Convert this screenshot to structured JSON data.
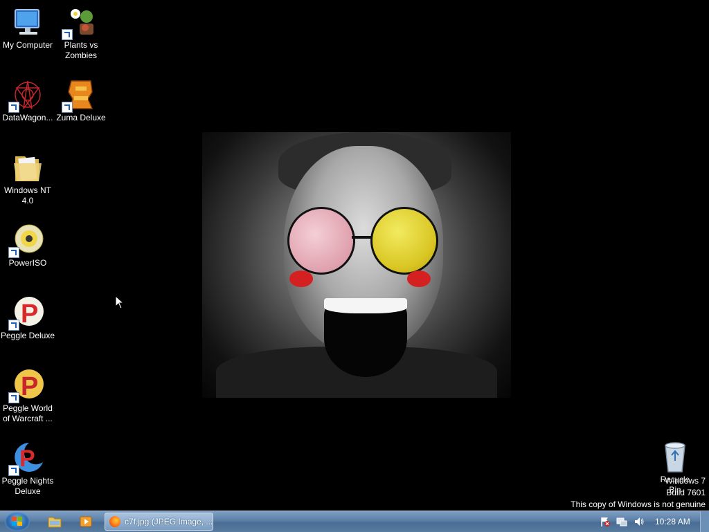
{
  "desktop": {
    "icons": [
      {
        "label": "My Computer",
        "icon": "computer-icon"
      },
      {
        "label": "Plants vs Zombies",
        "icon": "plants-vs-zombies-icon"
      },
      {
        "label": "DataWagon...",
        "icon": "datawagon-icon"
      },
      {
        "label": "Zuma Deluxe",
        "icon": "zuma-deluxe-icon"
      },
      {
        "label": "Windows NT 4.0",
        "icon": "folder-icon"
      },
      {
        "label": "PowerISO",
        "icon": "poweriso-disc-icon"
      },
      {
        "label": "Peggle Deluxe",
        "icon": "peggle-icon"
      },
      {
        "label": "Peggle World of Warcraft ...",
        "icon": "peggle-icon"
      },
      {
        "label": "Peggle Nights Deluxe",
        "icon": "peggle-nights-icon"
      }
    ],
    "recycle_bin": {
      "label": "Recycle Bin",
      "icon": "recycle-bin-icon"
    },
    "watermark": {
      "line1": "Windows 7",
      "line2": "Build 7601",
      "line3": "This copy of Windows is not genuine"
    }
  },
  "taskbar": {
    "start": {
      "icon": "windows-start-orb-icon"
    },
    "quick_launch": [
      {
        "icon": "windows-explorer-icon"
      },
      {
        "icon": "media-player-icon"
      }
    ],
    "windows": [
      {
        "title": "c7f.jpg (JPEG Image, ...",
        "icon": "firefox-icon"
      }
    ],
    "tray": {
      "icons": [
        "action-center-flag-icon",
        "network-icon",
        "volume-icon"
      ],
      "clock": "10:28 AM"
    }
  },
  "colors": {
    "desktop_bg": "#000000",
    "taskbar": "#5b7ea6",
    "lens_left": "#dfa0ad",
    "lens_right": "#d9c623",
    "blush": "#d42020"
  }
}
